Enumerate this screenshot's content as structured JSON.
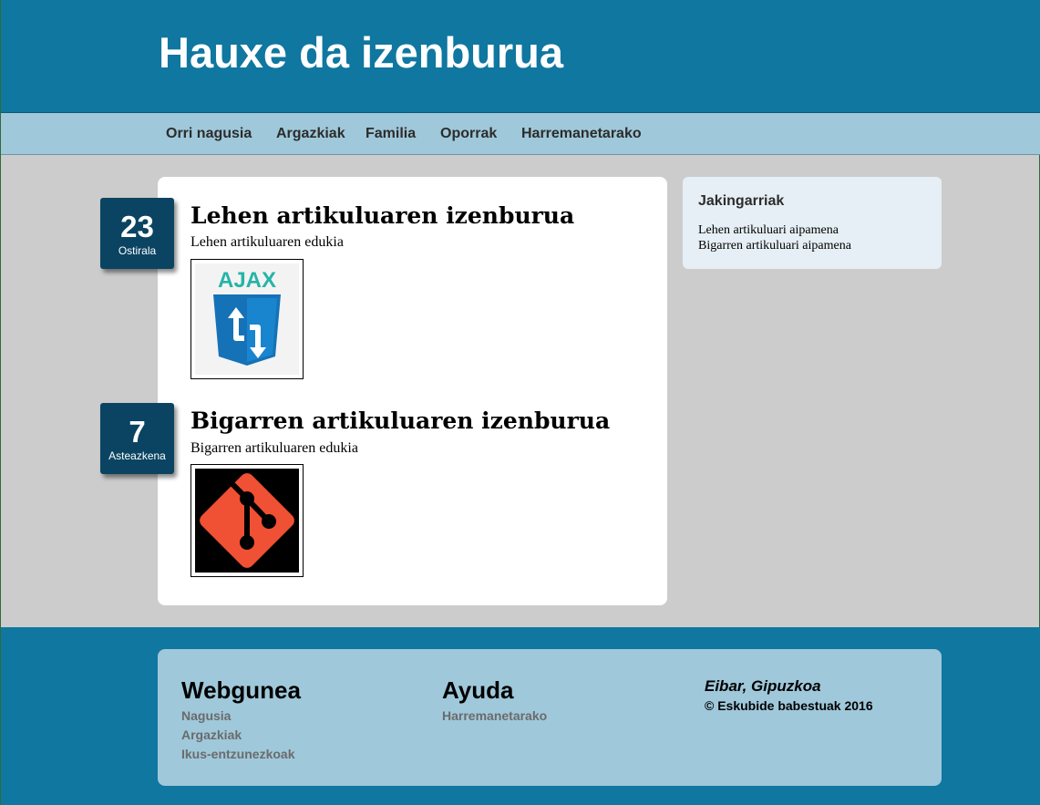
{
  "header": {
    "title": "Hauxe da izenburua"
  },
  "nav": {
    "items": [
      {
        "label": "Orri nagusia"
      },
      {
        "label": "Argazkiak"
      },
      {
        "label": "Familia"
      },
      {
        "label": "Oporrak"
      },
      {
        "label": "Harremanetarako"
      }
    ]
  },
  "articles": [
    {
      "day": "23",
      "weekday": "Ostirala",
      "title": "Lehen artikuluaren izenburua",
      "content": "Lehen artikuluaren edukia",
      "image": {
        "icon": "ajax-logo-icon",
        "text": "AJAX"
      }
    },
    {
      "day": "7",
      "weekday": "Asteazkena",
      "title": "Bigarren artikuluaren izenburua",
      "content": "Bigarren artikuluaren edukia",
      "image": {
        "icon": "git-logo-icon"
      }
    }
  ],
  "sidebar": {
    "title": "Jakingarriak",
    "links": [
      {
        "label": "Lehen artikuluari aipamena"
      },
      {
        "label": "Bigarren artikuluari aipamena"
      }
    ]
  },
  "footer": {
    "webgunea": {
      "heading": "Webgunea",
      "links": [
        {
          "label": "Nagusia"
        },
        {
          "label": "Argazkiak"
        },
        {
          "label": "Ikus-entzunezkoak"
        }
      ]
    },
    "ayuda": {
      "heading": "Ayuda",
      "links": [
        {
          "label": "Harremanetarako"
        }
      ]
    },
    "place": "Eibar, Gipuzkoa",
    "copyright": "© Eskubide babestuak 2016"
  },
  "colors": {
    "header_bg": "#0f77a0",
    "nav_bg": "#9fc8da",
    "badge_bg": "#0b4462",
    "page_bg": "#cccccc",
    "git_orange": "#f05033",
    "ajax_blue": "#1572b6",
    "ajax_teal": "#26b4a8"
  }
}
